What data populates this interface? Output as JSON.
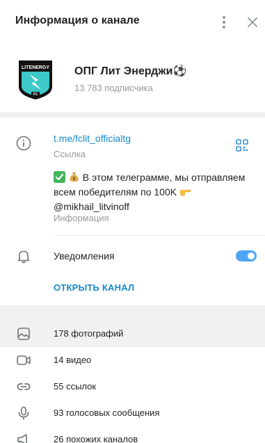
{
  "header": {
    "title": "Информация о канале",
    "menu_icon": "more-vertical-icon",
    "close_icon": "close-icon"
  },
  "profile": {
    "avatar_text": "LITENERGY",
    "avatar_sub": "FC",
    "name": "ОПГ Лит Энерджи⚽",
    "subscribers": "13 783 подписчика"
  },
  "info": {
    "link": "t.me/fclit_officialtg",
    "link_label": "Ссылка",
    "description_line1": " В этом телеграмме, мы отправляем",
    "description_line2": "всем победителям по 100K ",
    "description_line3": "@mikhail_litvinoff",
    "description_label": "Информация",
    "notifications_label": "Уведомления",
    "notifications_enabled": true,
    "open_channel": "ОТКРЫТЬ КАНАЛ"
  },
  "media": {
    "items": [
      {
        "label": "178 фотографий",
        "icon": "photo-icon"
      },
      {
        "label": "14 видео",
        "icon": "video-icon"
      },
      {
        "label": "55 ссылок",
        "icon": "link-icon"
      },
      {
        "label": "93 голосовых сообщения",
        "icon": "microphone-icon"
      },
      {
        "label": "26 похожих каналов",
        "icon": "megaphone-icon"
      }
    ]
  },
  "colors": {
    "accent": "#168acd",
    "toggle": "#4ea4f6",
    "avatar_badge": "#3ec9c9",
    "muted_text": "#999999"
  }
}
